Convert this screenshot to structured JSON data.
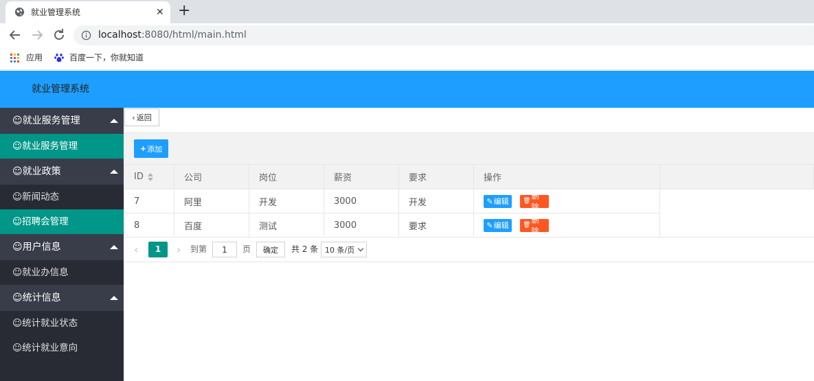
{
  "browser": {
    "tab_title": "就业管理系统",
    "url_host": "localhost",
    "url_rest": ":8080/html/main.html",
    "bookmarks": [
      {
        "label": "应用",
        "icon": "apps-grid-icon"
      },
      {
        "label": "百度一下，你就知道",
        "icon": "baidu-paw-icon"
      }
    ]
  },
  "header": {
    "title": "就业管理系统"
  },
  "sidebar": {
    "groups": [
      {
        "label": "☺就业服务管理",
        "items": [
          {
            "label": "☺就业服务管理",
            "active": true
          }
        ]
      },
      {
        "label": "☺就业政策",
        "items": [
          {
            "label": "☺新闻动态",
            "active": false
          },
          {
            "label": "☺招聘会管理",
            "active": true
          }
        ]
      },
      {
        "label": "☺用户信息",
        "items": [
          {
            "label": "☺就业办信息",
            "active": false
          }
        ]
      },
      {
        "label": "☺统计信息",
        "items": [
          {
            "label": "☺统计就业状态",
            "active": false
          },
          {
            "label": "☺统计就业意向",
            "active": false
          }
        ]
      }
    ]
  },
  "toolbar": {
    "back_label": "返回",
    "add_label": "添加"
  },
  "table": {
    "columns": [
      "ID",
      "公司",
      "岗位",
      "薪资",
      "要求",
      "操作"
    ],
    "rows": [
      {
        "id": "7",
        "company": "阿里",
        "position": "开发",
        "salary": "3000",
        "requirement": "开发"
      },
      {
        "id": "8",
        "company": "百度",
        "position": "测试",
        "salary": "3000",
        "requirement": "要求"
      }
    ],
    "edit_label": "编辑",
    "delete_label": "删除"
  },
  "pagination": {
    "current_page": "1",
    "goto_label": "到第",
    "page_input": "1",
    "page_unit": "页",
    "confirm_label": "确定",
    "total_label": "共 2 条",
    "page_size": "10 条/页"
  },
  "colors": {
    "header": "#1e9fff",
    "sidebar": "#282b33",
    "active": "#009688",
    "delete": "#ff5722"
  }
}
